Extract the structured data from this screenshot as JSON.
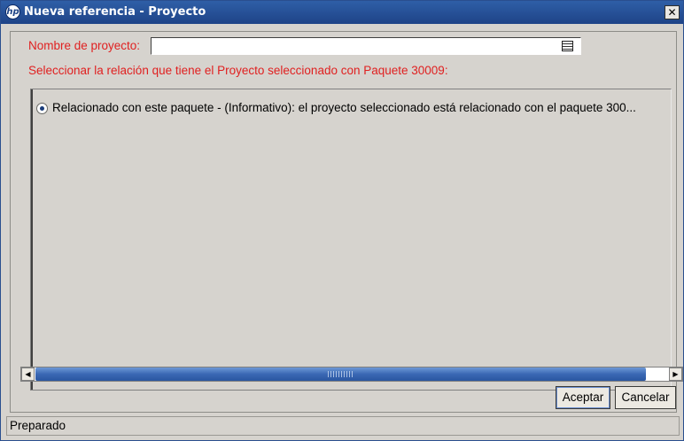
{
  "window": {
    "title": "Nueva referencia - Proyecto",
    "icon": "hp-logo-icon",
    "close_label": "✕"
  },
  "form": {
    "project_label": "Nombre de proyecto:",
    "project_value": "",
    "picker_icon": "list-picker-icon",
    "instruction": "Seleccionar la relación que tiene el Proyecto seleccionado con Paquete 30009:"
  },
  "relations": {
    "options": [
      {
        "label": "Relacionado con este paquete - (Informativo): el proyecto seleccionado está relacionado con el paquete 300...",
        "selected": true
      }
    ]
  },
  "scrollbar": {
    "left_arrow": "◀",
    "right_arrow": "▶"
  },
  "buttons": {
    "accept": "Aceptar",
    "cancel": "Cancelar"
  },
  "colors": {
    "title_bar": "#1e4387",
    "label_red": "#e02020",
    "scroll_thumb": "#3a68b4"
  },
  "status": {
    "text": "Preparado"
  }
}
